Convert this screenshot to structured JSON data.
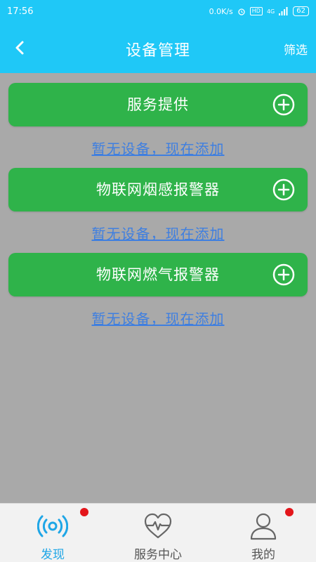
{
  "status_bar": {
    "time": "17:56",
    "network_speed": "0.0K/s",
    "hd": "HD",
    "signal": "4G",
    "battery": "62"
  },
  "header": {
    "title": "设备管理",
    "filter_label": "筛选"
  },
  "categories": [
    {
      "label": "服务提供",
      "empty_text": "暂无设备，现在添加"
    },
    {
      "label": "物联网烟感报警器",
      "empty_text": "暂无设备，现在添加"
    },
    {
      "label": "物联网燃气报警器",
      "empty_text": "暂无设备，现在添加"
    }
  ],
  "bottom_nav": [
    {
      "label": "发现",
      "icon": "signal-icon",
      "active": true,
      "badge": true
    },
    {
      "label": "服务中心",
      "icon": "heart-pulse-icon",
      "active": false,
      "badge": false
    },
    {
      "label": "我的",
      "icon": "user-icon",
      "active": false,
      "badge": true
    }
  ],
  "colors": {
    "header": "#1fc8f7",
    "card": "#2fb34a",
    "link": "#3f7fe0",
    "background": "#a9a9a9",
    "active_nav": "#1fa6e6",
    "badge": "#e3161b"
  }
}
